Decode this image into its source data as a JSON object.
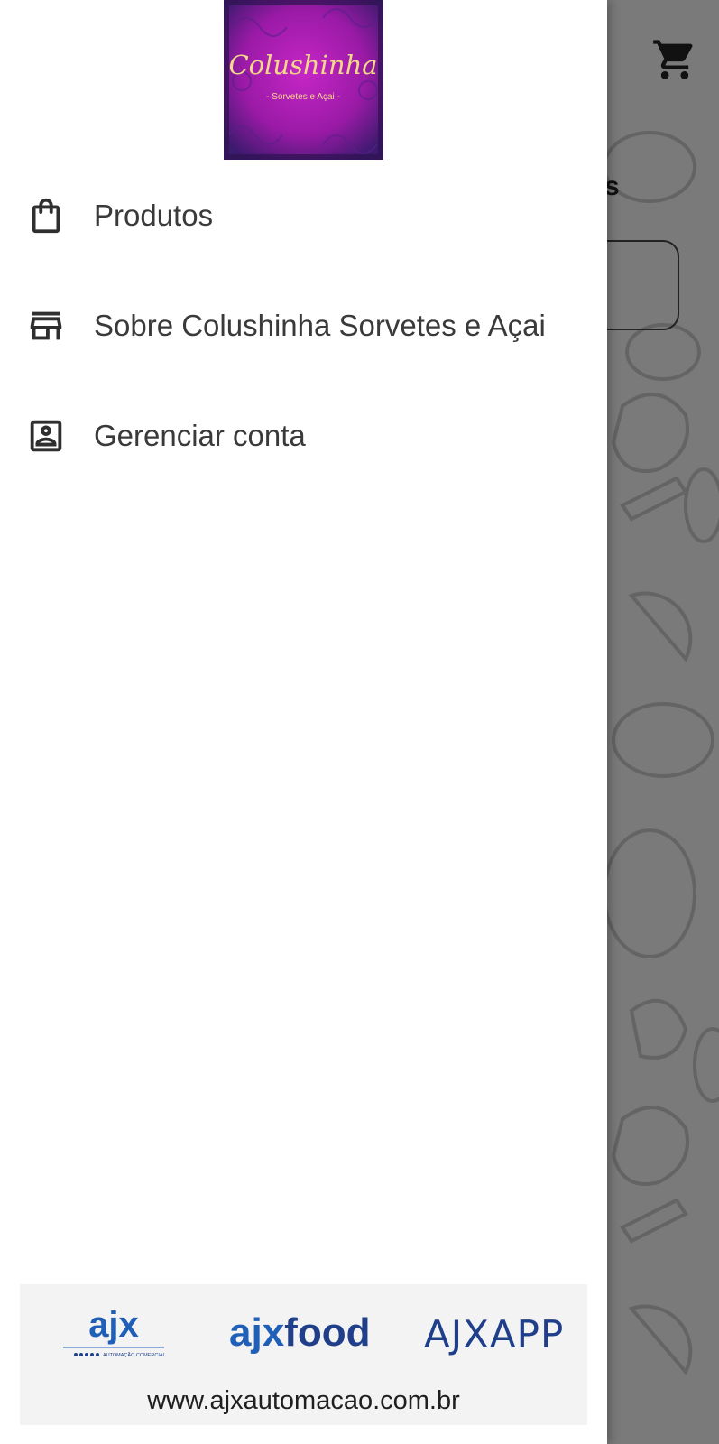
{
  "background": {
    "title_fragment": "s",
    "cart_icon": "shopping-cart-icon"
  },
  "drawer": {
    "logo": {
      "name": "Colushinha",
      "tagline": "- Sorvetes e Açai -"
    },
    "menu": [
      {
        "label": "Produtos",
        "icon": "shopping-bag-icon"
      },
      {
        "label": "Sobre Colushinha Sorvetes e Açai",
        "icon": "store-icon"
      },
      {
        "label": "Gerenciar conta",
        "icon": "account-box-icon"
      }
    ],
    "footer": {
      "logos": {
        "ajx": "ajx",
        "ajx_sub": "AUTOMAÇÃO COMERCIAL",
        "ajxfood_prefix": "ajx",
        "ajxfood_suffix": "food",
        "ajxapp": "AJXAPP"
      },
      "url": "www.ajxautomacao.com.br"
    }
  },
  "colors": {
    "drawer_bg": "#ffffff",
    "scrim_bg": "#7a7a7a",
    "menu_text": "#3a3a3a",
    "footer_bg": "#f3f3f3",
    "logo_purple": "#a11fa6",
    "ajx_blue": "#1f5fb8"
  }
}
